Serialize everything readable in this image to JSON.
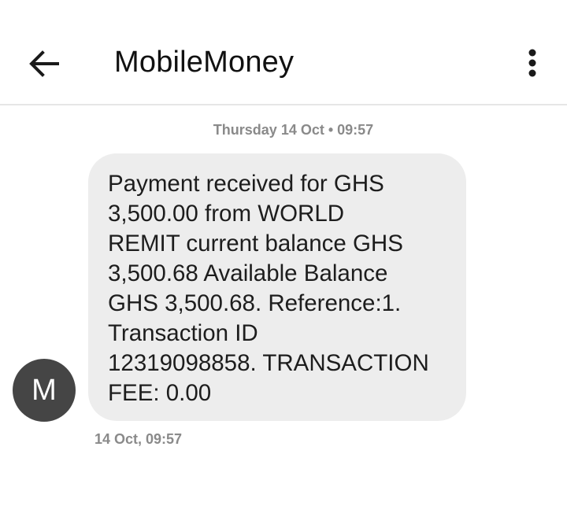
{
  "header": {
    "title": "MobileMoney",
    "back_icon": "arrow-left-icon",
    "menu_icon": "more-vertical-icon"
  },
  "conversation": {
    "date_separator": "Thursday 14 Oct • 09:57",
    "sender_initial": "M",
    "message": {
      "lines": [
        "Payment received for GHS",
        "3,500.00 from WORLD",
        "REMIT current balance GHS",
        "3,500.68 Available Balance",
        "GHS 3,500.68. Reference:1.",
        "Transaction ID",
        "12319098858. TRANSACTION",
        "FEE: 0.00"
      ],
      "timestamp": "14 Oct, 09:57"
    }
  },
  "colors": {
    "bubble": "#ededed",
    "avatar": "#454545",
    "meta_text": "#8a8a8a"
  }
}
